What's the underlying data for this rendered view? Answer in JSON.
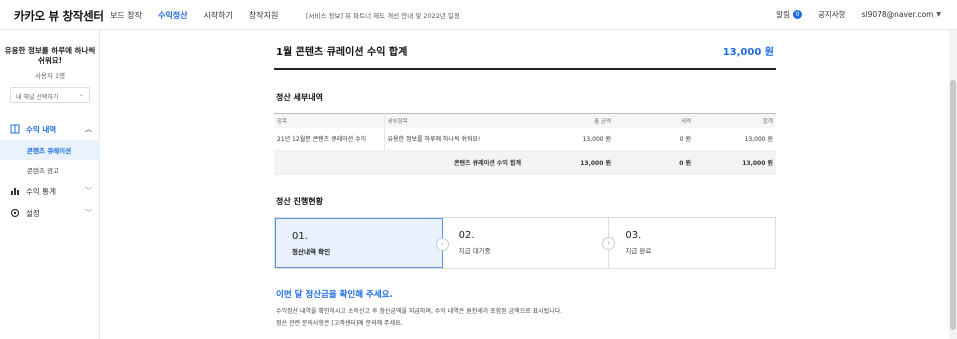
{
  "header": {
    "logo": "카카오 뷰 창작센터",
    "gnb": [
      {
        "label": "보드 창작",
        "active": false
      },
      {
        "label": "수익정산",
        "active": true
      },
      {
        "label": "시작하기",
        "active": false
      },
      {
        "label": "창작지원",
        "active": false
      }
    ],
    "notice": "[서비스 정보] 뷰 파트너 제도 개선 안내 및 2022년 일정",
    "alarm_label": "알림",
    "alarm_count": "0",
    "notice_link": "공지사항",
    "account": "sl9078@naver.com"
  },
  "sidebar": {
    "profile_name": "유용한 정보를 하루에 하나씩 쉬워요!",
    "profile_sub": "사용자 1명",
    "select_label": "내 채널 선택하기",
    "nav": [
      {
        "label": "수익 내역",
        "icon": "document-icon",
        "active": true,
        "expanded": true,
        "sub": [
          {
            "label": "콘텐츠 큐레이션",
            "active": true
          },
          {
            "label": "콘텐츠 광고",
            "active": false
          }
        ]
      },
      {
        "label": "수익 통계",
        "icon": "bar-chart-icon",
        "active": false,
        "expanded": false,
        "sub": []
      },
      {
        "label": "설정",
        "icon": "gear-icon",
        "active": false,
        "expanded": false,
        "sub": []
      }
    ]
  },
  "summary": {
    "title": "1월 콘텐츠 큐레이션 수익 합계",
    "amount": "13,000 원"
  },
  "detail": {
    "title": "정산 세부내역",
    "columns": [
      "항목",
      "세부항목",
      "총 금액",
      "세액",
      "합계"
    ],
    "rows": [
      [
        "21년 12월분 콘텐츠 큐레이션 수익",
        "유용한 정보를 하루에 하나씩 쉬워요!",
        "13,000 원",
        "0 원",
        "13,000 원"
      ]
    ],
    "total": {
      "label": "콘텐츠 큐레이션 수익 합계",
      "gross": "13,000 원",
      "tax": "0 원",
      "sum": "13,000 원"
    }
  },
  "progress": {
    "title": "정산 진행현황",
    "steps": [
      {
        "num": "01.",
        "label": "정산내역 확인",
        "active": true
      },
      {
        "num": "02.",
        "label": "지급 대기중",
        "active": false
      },
      {
        "num": "03.",
        "label": "지급 완료",
        "active": false
      }
    ]
  },
  "message": {
    "title": "이번 달 정산금을 확인해 주세요.",
    "line1": "수익정산 내역을 확인하시고 소득신고 후 정산금액을 지급하며, 수익 내역은 원천세가 포함된 금액으로 표시됩니다.",
    "line2": "정산 관련 문의사항은 [고객센터]에 문의해 주세요."
  },
  "colors": {
    "accent": "#1b6ce3",
    "active_bg": "#e9f1fd"
  }
}
